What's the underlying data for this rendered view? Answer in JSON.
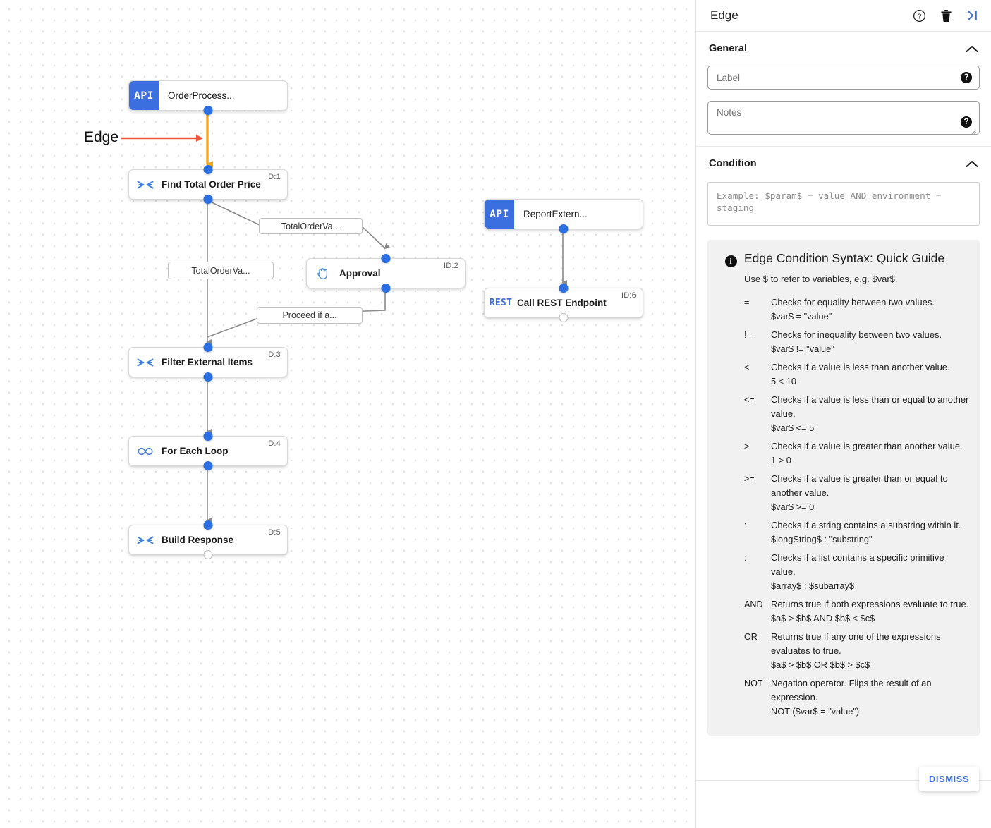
{
  "canvas": {
    "annotation": {
      "label": "Edge",
      "arrow_color": "#f0533c"
    },
    "highlighted_edge_color": "#f5a623",
    "nodes": [
      {
        "id": "n0",
        "badge": "API",
        "title": "OrderProcess...",
        "kind": "api",
        "id_label": ""
      },
      {
        "id": "n1",
        "badge": "",
        "title": "Find Total Order Price",
        "kind": "transform",
        "id_label": "ID:1"
      },
      {
        "id": "n2",
        "badge": "",
        "title": "Approval",
        "kind": "approval",
        "id_label": "ID:2"
      },
      {
        "id": "n3",
        "badge": "",
        "title": "Filter External Items",
        "kind": "transform",
        "id_label": "ID:3"
      },
      {
        "id": "n4",
        "badge": "",
        "title": "For Each Loop",
        "kind": "loop",
        "id_label": "ID:4"
      },
      {
        "id": "n5",
        "badge": "",
        "title": "Build Response",
        "kind": "transform",
        "id_label": "ID:5"
      },
      {
        "id": "n6",
        "badge": "API",
        "title": "ReportExtern...",
        "kind": "api",
        "id_label": ""
      },
      {
        "id": "n7",
        "badge": "REST",
        "title": "Call REST Endpoint",
        "kind": "rest",
        "id_label": "ID:6"
      }
    ],
    "edge_labels": [
      {
        "text": "TotalOrderVa..."
      },
      {
        "text": "TotalOrderVa..."
      },
      {
        "text": "Proceed if a..."
      }
    ]
  },
  "panel": {
    "title": "Edge",
    "header_icons": [
      {
        "name": "help-icon",
        "glyph": "?"
      },
      {
        "name": "delete-icon",
        "glyph": "trash"
      },
      {
        "name": "collapse-panel-icon",
        "glyph": ">|"
      }
    ],
    "general": {
      "heading": "General",
      "label_field_placeholder": "Label",
      "notes_field_placeholder": "Notes",
      "label_field_value": "",
      "notes_field_value": ""
    },
    "condition": {
      "heading": "Condition",
      "textarea_placeholder": "Example: $param$ = value AND environment = staging",
      "textarea_value": ""
    },
    "guide": {
      "title": "Edge Condition Syntax: Quick Guide",
      "subtitle": "Use $ to refer to variables, e.g. $var$.",
      "operators": [
        {
          "key": "=",
          "desc": "Checks for equality between two values.",
          "example": "$var$ = \"value\""
        },
        {
          "key": "!=",
          "desc": "Checks for inequality between two values.",
          "example": "$var$ != \"value\""
        },
        {
          "key": "<",
          "desc": "Checks if a value is less than another value.",
          "example": "5 < 10"
        },
        {
          "key": "<=",
          "desc": "Checks if a value is less than or equal to another value.",
          "example": "$var$ <= 5"
        },
        {
          "key": ">",
          "desc": "Checks if a value is greater than another value.",
          "example": "1 > 0"
        },
        {
          "key": ">=",
          "desc": "Checks if a value is greater than or equal to another value.",
          "example": "$var$ >= 0"
        },
        {
          "key": ":",
          "desc": "Checks if a string contains a substring within it.",
          "example": "$longString$ : \"substring\""
        },
        {
          "key": ":",
          "desc": "Checks if a list contains a specific primitive value.",
          "example": "$array$ : $subarray$"
        },
        {
          "key": "AND",
          "desc": "Returns true if both expressions evaluate to true.",
          "example": "$a$ > $b$ AND $b$ < $c$"
        },
        {
          "key": "OR",
          "desc": "Returns true if any one of the expressions evaluates to true.",
          "example": "$a$ > $b$ OR $b$ > $c$"
        },
        {
          "key": "NOT",
          "desc": "Negation operator. Flips the result of an expression.",
          "example": "NOT ($var$ = \"value\")"
        }
      ]
    },
    "footer": {
      "dismiss_label": "DISMISS",
      "accent_color": "#3b6fe0"
    }
  }
}
